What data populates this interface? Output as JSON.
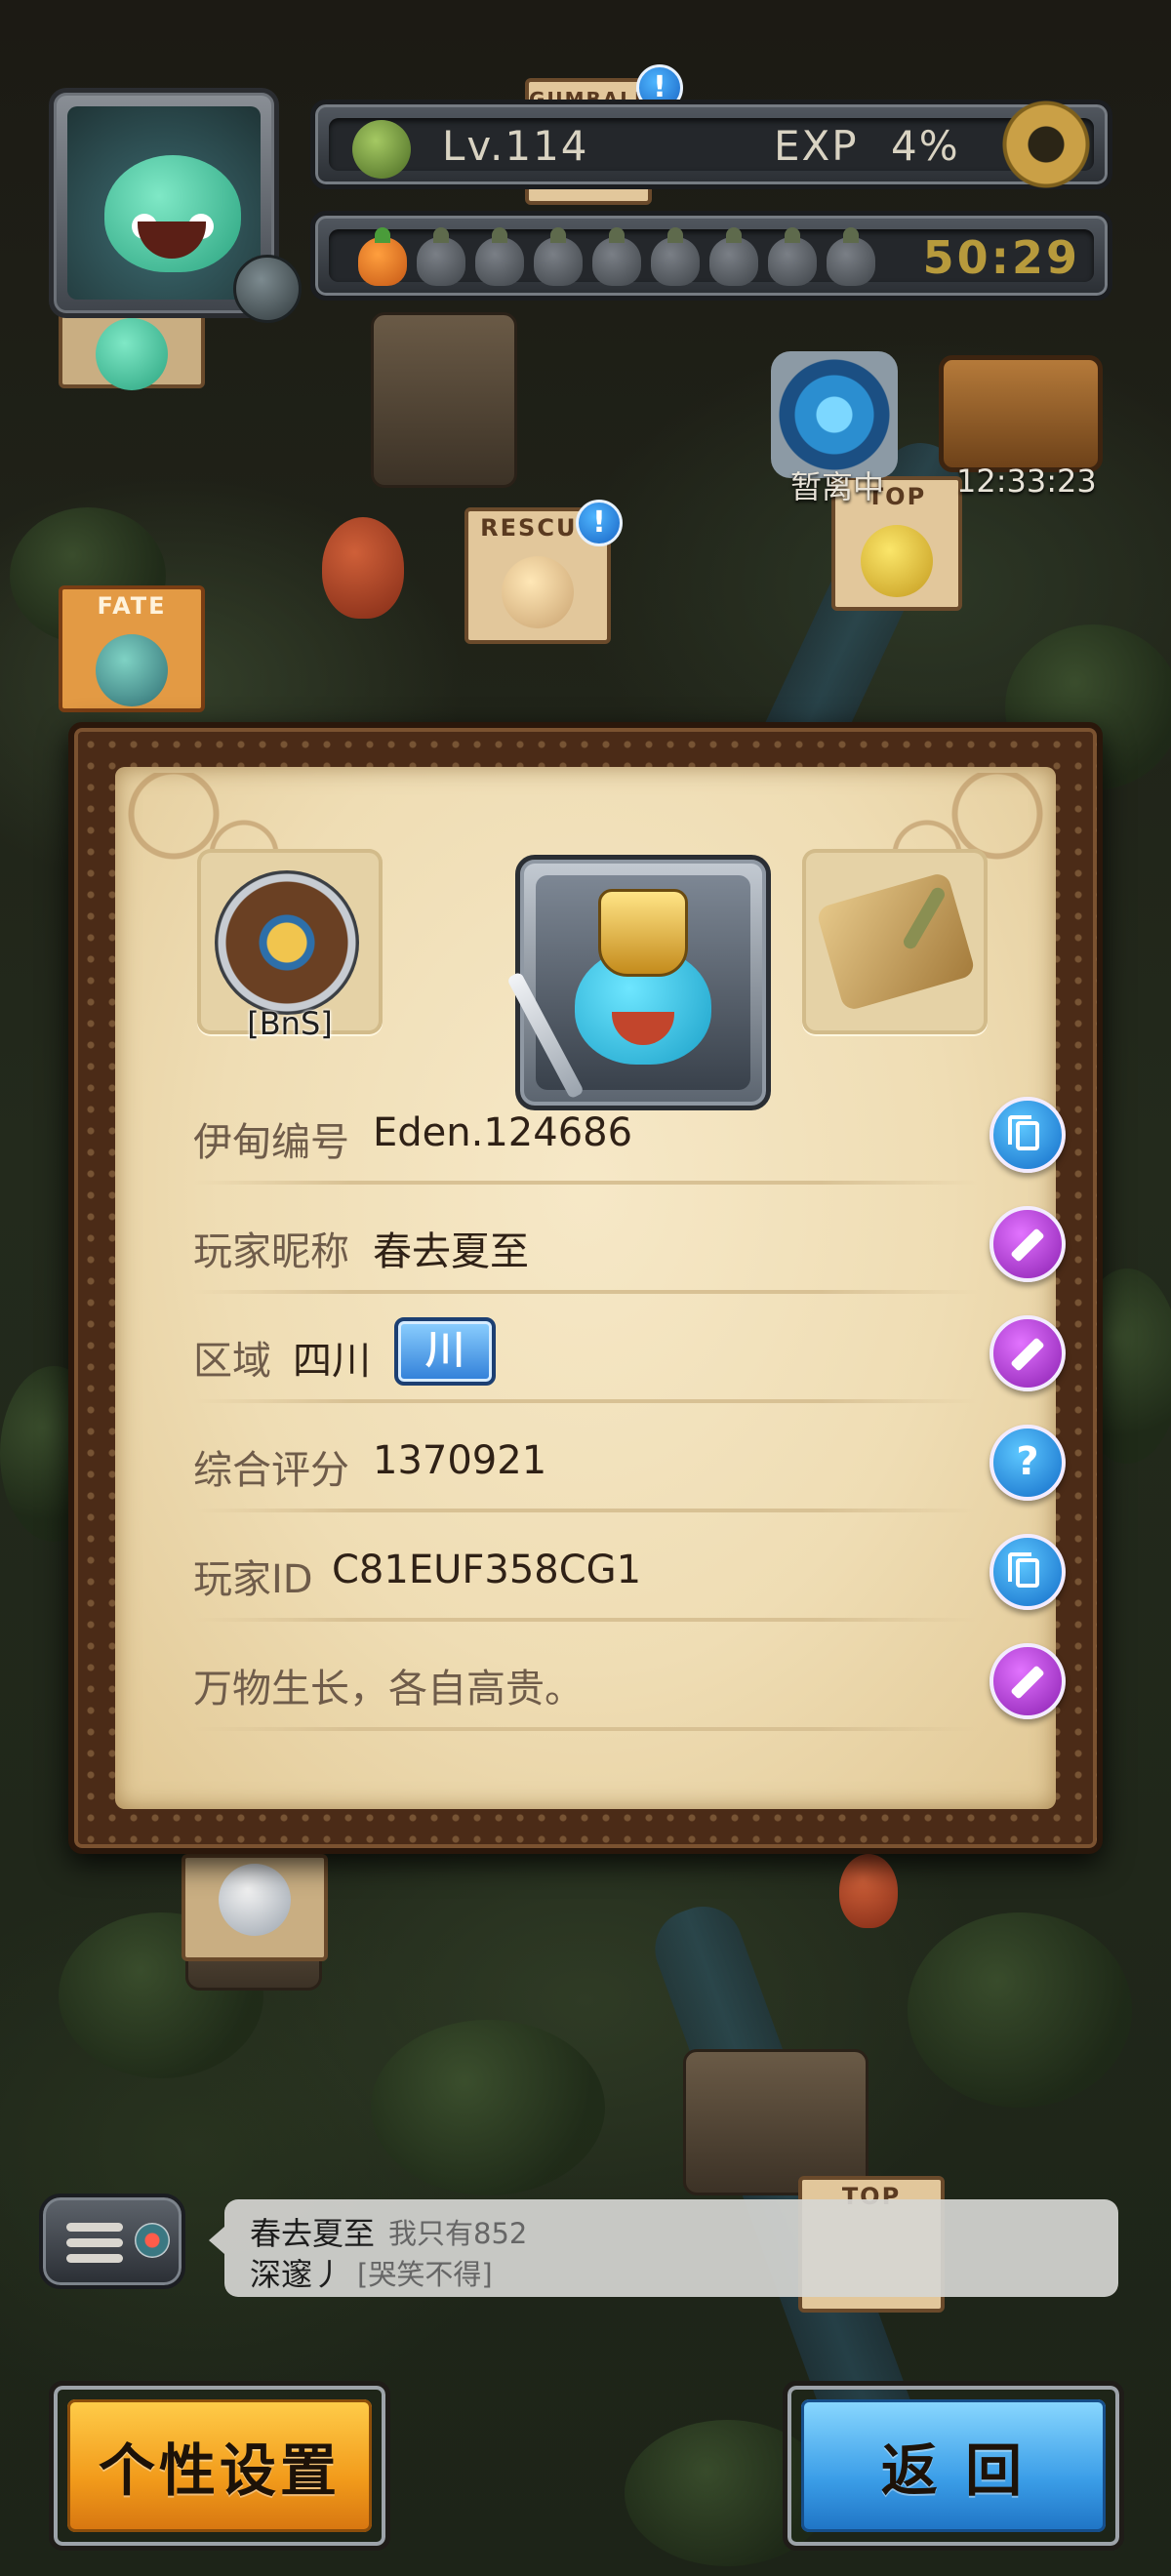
{
  "hud": {
    "level_text": "Lv.114",
    "exp_label": "EXP",
    "exp_value": "4%",
    "stamina": {
      "filled": 1,
      "total": 9
    },
    "timer": "50:29"
  },
  "map": {
    "sign_gumball": "GUMBALL",
    "sign_rescue": "RESCUE",
    "sign_fate": "FATE",
    "sign_top": "TOP",
    "sign_top2": "TOP",
    "portal_status": "暂离中",
    "chest_timer": "12:33:23"
  },
  "profile": {
    "guild_tag": "[BnS]",
    "rows": [
      {
        "label": "伊甸编号",
        "value": "Eden.124686",
        "action_icon": "copy-icon",
        "action_color": "#1f86e0"
      },
      {
        "label": "玩家昵称",
        "value": "春去夏至",
        "action_icon": "pencil-icon",
        "action_color": "#a62fd0"
      },
      {
        "label": "区域",
        "value": "四川",
        "badge": "川",
        "action_icon": "pencil-icon",
        "action_color": "#a62fd0"
      },
      {
        "label": "综合评分",
        "value": "1370921",
        "action_icon": "help-icon",
        "action_color": "#1f86e0"
      },
      {
        "label": "玩家ID",
        "value": "C81EUF358CG1",
        "action_icon": "copy-icon",
        "action_color": "#1f86e0"
      },
      {
        "label": "万物生长，各自高贵。",
        "value": "",
        "action_icon": "pencil-icon",
        "action_color": "#a62fd0"
      }
    ],
    "help_glyph": "?"
  },
  "chat": {
    "line1": {
      "name": "春去夏至",
      "message": "我只有852"
    },
    "line2": {
      "name": "深邃丿",
      "message": "[哭笑不得]"
    }
  },
  "buttons": {
    "settings_label": "个性设置",
    "back_label": "返 回"
  },
  "colors": {
    "accent_orange": "#f29b1b",
    "accent_blue": "#3b9ee8",
    "timer_gold": "#b79a3c"
  }
}
